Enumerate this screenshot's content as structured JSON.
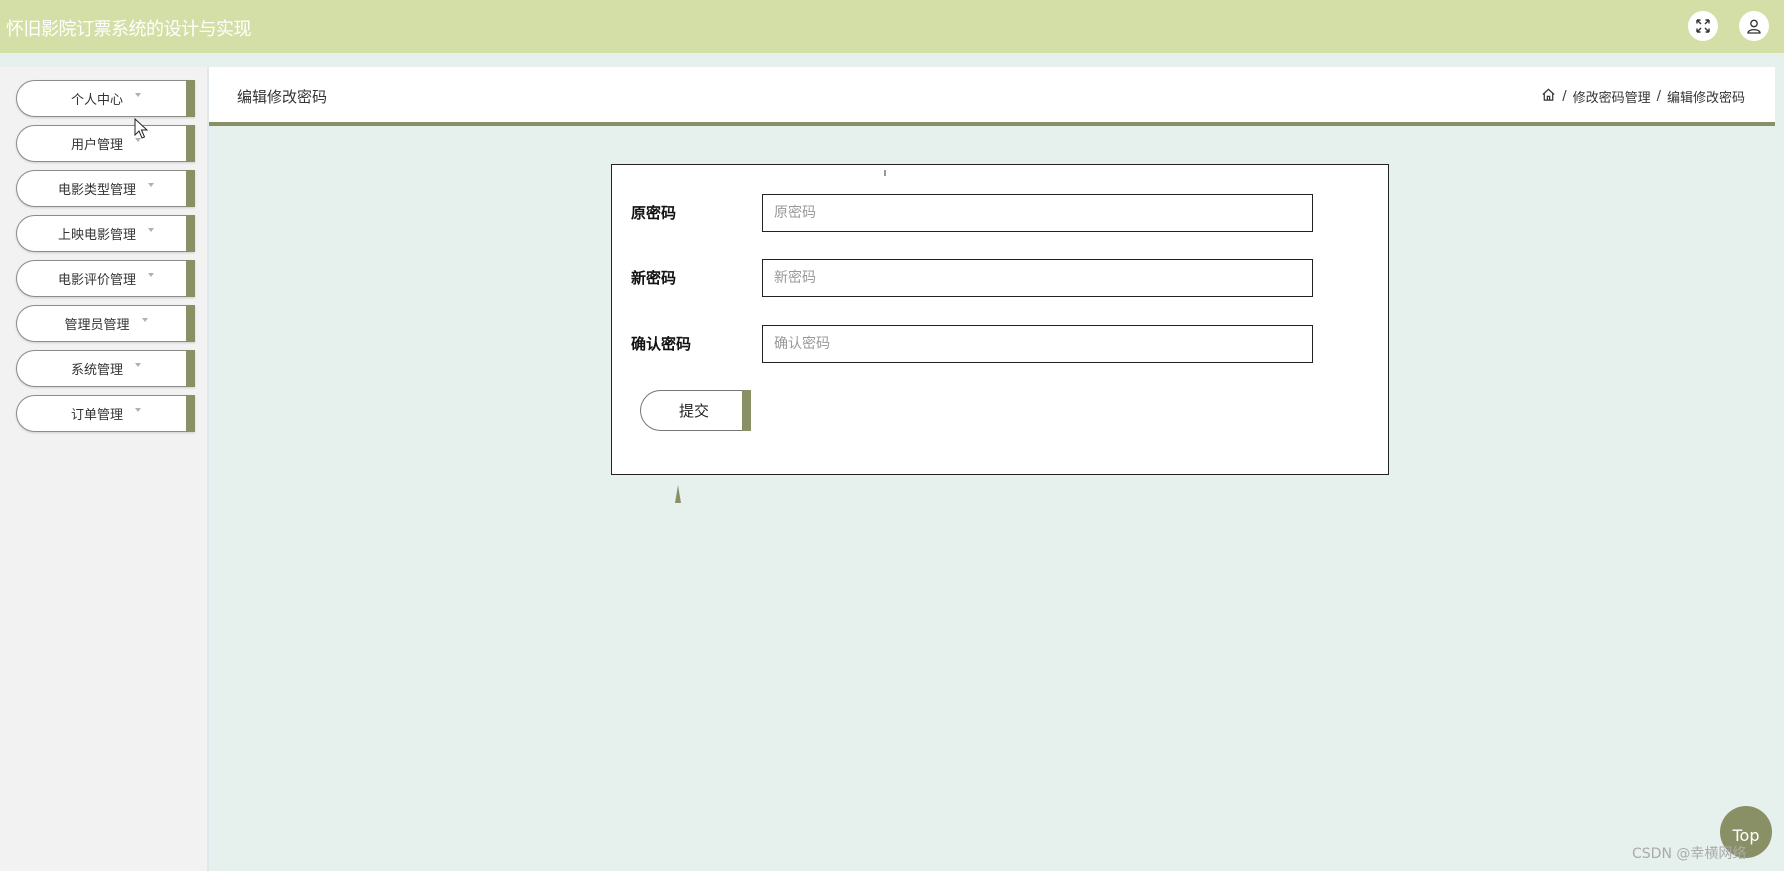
{
  "app": {
    "title": "怀旧影院订票系统的设计与实现"
  },
  "topbar": {
    "icons": [
      "fullscreen-icon",
      "user-icon"
    ]
  },
  "sidebar": {
    "items": [
      {
        "label": "个人中心"
      },
      {
        "label": "用户管理"
      },
      {
        "label": "电影类型管理"
      },
      {
        "label": "上映电影管理"
      },
      {
        "label": "电影评价管理"
      },
      {
        "label": "管理员管理"
      },
      {
        "label": "系统管理"
      },
      {
        "label": "订单管理"
      }
    ]
  },
  "header": {
    "title": "编辑修改密码",
    "breadcrumb": {
      "sep": "/",
      "section": "修改密码管理",
      "current": "编辑修改密码"
    }
  },
  "form": {
    "old_password": {
      "label": "原密码",
      "placeholder": "原密码",
      "value": ""
    },
    "new_password": {
      "label": "新密码",
      "placeholder": "新密码",
      "value": ""
    },
    "confirm_password": {
      "label": "确认密码",
      "placeholder": "确认密码",
      "value": ""
    },
    "submit_label": "提交"
  },
  "back_to_top": {
    "label": "Top"
  },
  "watermark": "CSDN @幸横网络",
  "colors": {
    "topbar": "#d3dfa6",
    "accent": "#8a9065",
    "content_bg": "#e6f1ed",
    "sidebar_bg": "#f2f2f2"
  }
}
